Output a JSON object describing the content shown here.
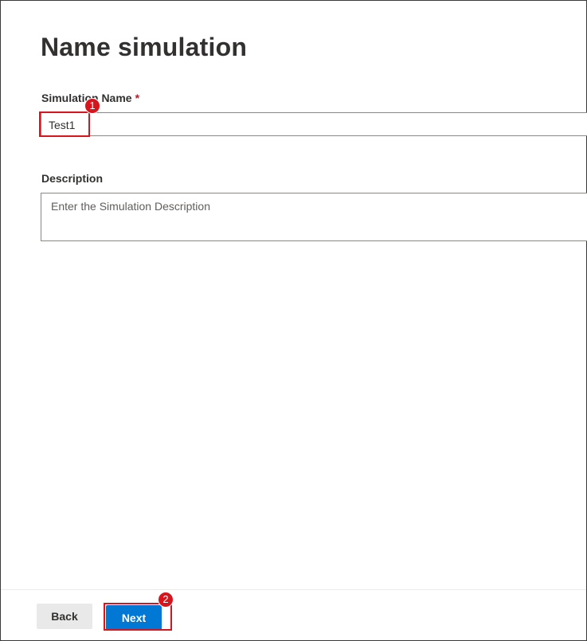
{
  "page": {
    "title": "Name simulation"
  },
  "form": {
    "name_label": "Simulation Name",
    "required_marker": "*",
    "name_value": "Test1",
    "description_label": "Description",
    "description_placeholder": "Enter the Simulation Description"
  },
  "footer": {
    "back_label": "Back",
    "next_label": "Next"
  },
  "annotations": {
    "step1": "1",
    "step2": "2",
    "highlight_color": "#d8141c"
  },
  "colors": {
    "primary_button": "#0078d4",
    "secondary_button": "#e9e9e9",
    "required": "#a4262c"
  }
}
